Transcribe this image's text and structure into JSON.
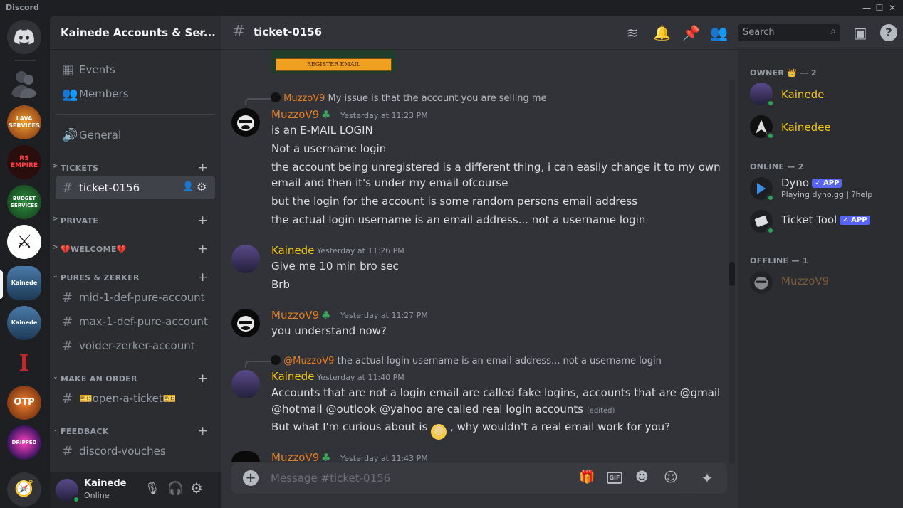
{
  "window": {
    "app_name": "Discord"
  },
  "server_rail": {
    "servers": [
      {
        "name": "direct-messages",
        "label": ""
      },
      {
        "name": "server-shadow",
        "label": ""
      },
      {
        "name": "server-lava-services",
        "label": "LAVA SERVICES",
        "color": "#a0521b"
      },
      {
        "name": "server-rs-empire",
        "label": "RS EMPIRE",
        "color": "#3a1010"
      },
      {
        "name": "server-budget-services",
        "label": "BUDGET SERVICES",
        "color": "#1c5a2a"
      },
      {
        "name": "server-swords",
        "label": "⚔",
        "color": "#e9e9e9"
      },
      {
        "name": "server-kainede-1",
        "label": "Kainede",
        "color": "#2b4d6b"
      },
      {
        "name": "server-kainede-2",
        "label": "Kainede",
        "color": "#2e506e"
      },
      {
        "name": "server-red-letter",
        "label": "I",
        "color": "#1e1f22"
      },
      {
        "name": "server-otp",
        "label": "OTP",
        "color": "#5a2b0e"
      },
      {
        "name": "server-dripped",
        "label": "DRIPPED",
        "color": "#3b1560"
      }
    ],
    "discover_icon": "compass-icon"
  },
  "sidebar": {
    "guild_name": "Kainede Accounts & Ser...",
    "top_items": [
      {
        "label": "Events",
        "icon": "calendar-icon"
      },
      {
        "label": "Members",
        "icon": "members-icon"
      }
    ],
    "general": {
      "label": "General",
      "icon": "speaker-icon"
    },
    "categories": [
      {
        "label": "TICKETS",
        "channels": [
          {
            "label": "ticket-0156",
            "active": true
          }
        ]
      },
      {
        "label": "PRIVATE",
        "channels": []
      },
      {
        "label": "💔WELCOME💔",
        "channels": []
      },
      {
        "label": "PURES & ZERKER",
        "channels": [
          {
            "label": "mid-1-def-pure-account"
          },
          {
            "label": "max-1-def-pure-account"
          },
          {
            "label": "voider-zerker-account"
          }
        ]
      },
      {
        "label": "MAKE AN ORDER",
        "channels": [
          {
            "label": "🎫open-a-ticket🎫"
          }
        ]
      },
      {
        "label": "FEEDBACK",
        "channels": [
          {
            "label": "discord-vouches"
          }
        ]
      }
    ],
    "user": {
      "name": "Kainede",
      "status": "Online"
    }
  },
  "chat": {
    "channel_name": "ticket-0156",
    "search_placeholder": "Search",
    "composer_placeholder": "Message #ticket-0156",
    "embed_button": "REGISTER EMAIL",
    "messages": [
      {
        "reply_to": {
          "author": "MuzzoV9",
          "text": "My issue is that the account you are selling me"
        },
        "author": "MuzzoV9",
        "author_color": "#e67e22",
        "timestamp": "Yesterday at 11:23 PM",
        "lines": [
          "is an E-MAIL LOGIN",
          "Not a username login",
          "the account being unregistered is a different thing, i can easily change it to my own",
          "email and then it's under my email ofcourse",
          "but the login for the account is some random persons email address",
          "the actual login username is an email address... not a username login"
        ]
      },
      {
        "author": "Kainede",
        "author_color": "#f1c40f",
        "timestamp": "Yesterday at 11:26 PM",
        "lines": [
          "Give me 10 min bro sec",
          "Brb"
        ]
      },
      {
        "author": "MuzzoV9",
        "author_color": "#e67e22",
        "timestamp": "Yesterday at 11:27 PM",
        "lines": [
          "you understand now?"
        ]
      },
      {
        "reply_to": {
          "author": "@MuzzoV9",
          "text": "the actual login username is an email address... not a username login"
        },
        "author": "Kainede",
        "author_color": "#f1c40f",
        "timestamp": "Yesterday at 11:40 PM",
        "lines": [
          "Accounts that are not a login email are called fake logins, accounts that are @gmail",
          "@hotmail @outlook @yahoo are called real login accounts",
          "But what I'm curious about is",
          ", why wouldn't a real email work for you?"
        ],
        "edited": "(edited)"
      },
      {
        "author": "MuzzoV9",
        "author_color": "#e67e22",
        "timestamp": "Yesterday at 11:43 PM",
        "lines": []
      }
    ]
  },
  "members": {
    "groups": [
      {
        "label": "OWNER",
        "crown": "👑",
        "count": "— 2",
        "members": [
          {
            "name": "Kainede",
            "color": "#f1c40f"
          },
          {
            "name": "Kainedee",
            "color": "#f1c40f"
          }
        ]
      },
      {
        "label": "ONLINE",
        "count": "— 2",
        "members": [
          {
            "name": "Dyno",
            "badge": "APP",
            "activity": "Playing dyno.gg | ?help",
            "color": "#dbdee1"
          },
          {
            "name": "Ticket Tool",
            "badge": "APP",
            "color": "#dbdee1"
          }
        ]
      },
      {
        "label": "OFFLINE",
        "count": "— 1",
        "members": [
          {
            "name": "MuzzoV9",
            "color": "#7a5a3a"
          }
        ]
      }
    ]
  }
}
